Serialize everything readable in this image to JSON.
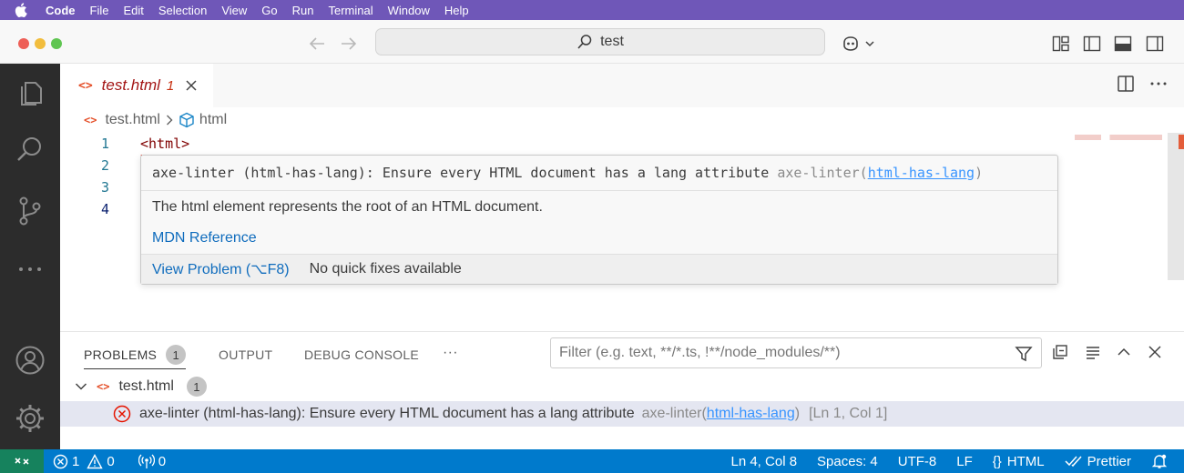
{
  "menubar": {
    "items": [
      "Code",
      "File",
      "Edit",
      "Selection",
      "View",
      "Go",
      "Run",
      "Terminal",
      "Window",
      "Help"
    ]
  },
  "titlebar": {
    "search_text": "test"
  },
  "tab": {
    "title": "test.html",
    "problem_count": "1",
    "icon_glyph": "<>"
  },
  "breadcrumbs": {
    "file": "test.html",
    "symbol": "html"
  },
  "editor": {
    "line_numbers": [
      "1",
      "2",
      "3",
      "4"
    ],
    "line1": "<html>"
  },
  "hover": {
    "diagnostic_message": "axe-linter (html-has-lang): Ensure every HTML document has a lang attribute",
    "diagnostic_source": "axe-linter(",
    "diagnostic_rule": "html-has-lang",
    "diagnostic_close": ")",
    "description": "The html element represents the root of an HTML document.",
    "mdn_link": "MDN Reference",
    "view_problem": "View Problem (⌥F8)",
    "no_fixes": "No quick fixes available"
  },
  "panel": {
    "tabs": {
      "problems": "PROBLEMS",
      "problems_count": "1",
      "output": "OUTPUT",
      "debug_console": "DEBUG CONSOLE",
      "more": "···"
    },
    "filter_placeholder": "Filter (e.g. text, **/*.ts, !**/node_modules/**)",
    "file_group": {
      "name": "test.html",
      "count": "1"
    },
    "problem": {
      "message": "axe-linter (html-has-lang): Ensure every HTML document has a lang attribute",
      "source": "axe-linter(",
      "rule": "html-has-lang",
      "close": ")",
      "position": "[Ln 1, Col 1]"
    }
  },
  "statusbar": {
    "errors": "1",
    "warnings": "0",
    "ports": "0",
    "cursor": "Ln 4, Col 8",
    "spaces": "Spaces: 4",
    "encoding": "UTF-8",
    "eol": "LF",
    "language": "HTML",
    "formatter": "Prettier"
  },
  "colors": {
    "menubar": "#6f57b8",
    "activitybar": "#2c2c2c",
    "statusbar": "#007acc",
    "remote": "#16825d",
    "error": "#e51400",
    "link": "#0f6cbd"
  }
}
